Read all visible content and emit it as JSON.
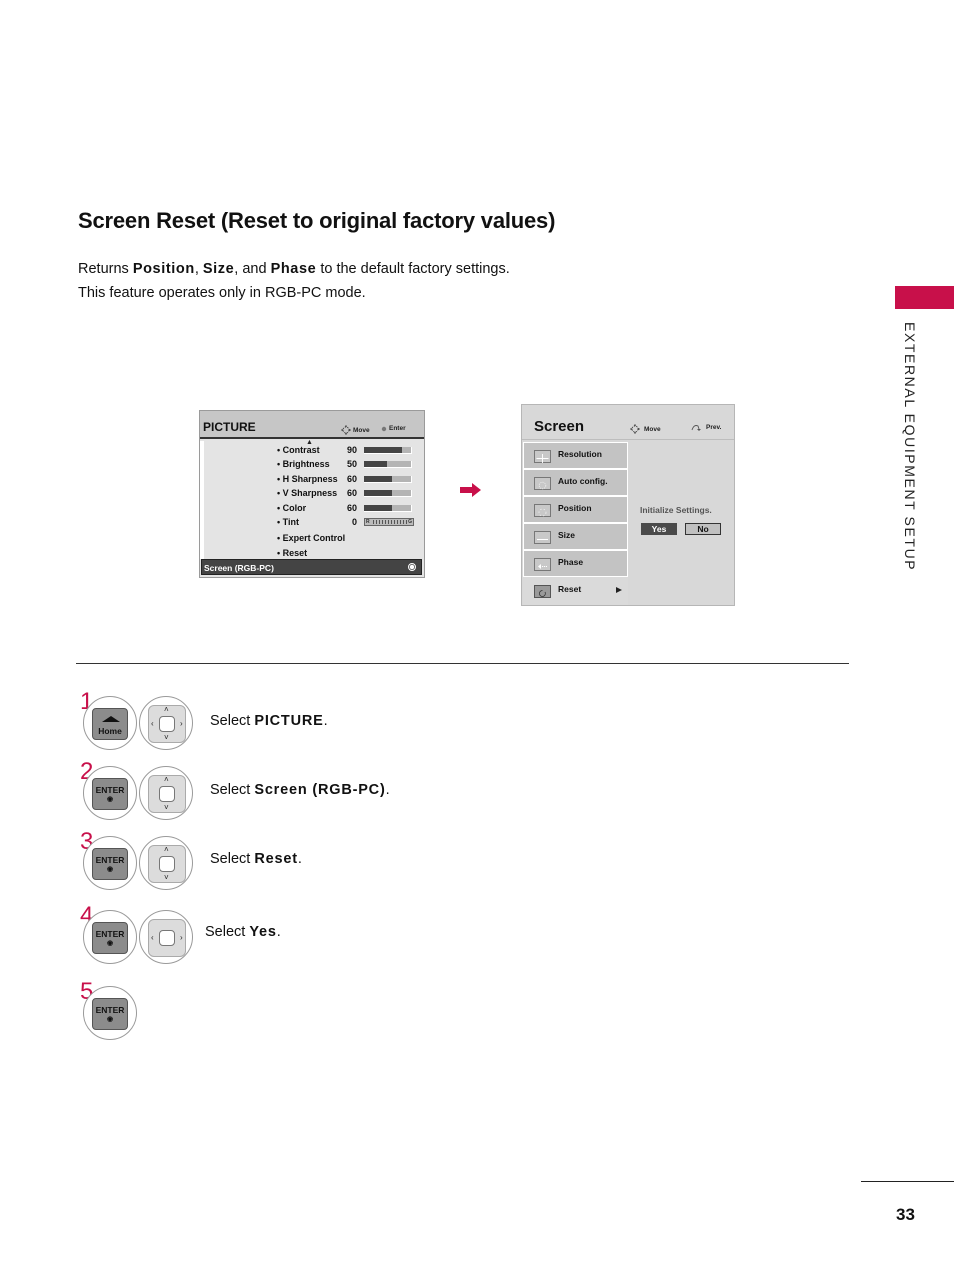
{
  "page": {
    "title": "Screen Reset (Reset to original factory values)",
    "intro_line1": {
      "prefix": "Returns ",
      "term1": "Position",
      "sep1": ", ",
      "term2": "Size",
      "sep2": ", and ",
      "term3": "Phase",
      "suffix": " to the default factory settings."
    },
    "intro_line2": "This feature operates only in RGB-PC mode.",
    "side_label": "EXTERNAL EQUIPMENT SETUP",
    "page_number": "33",
    "accent_color": "#c8104a"
  },
  "picture_menu": {
    "title": "PICTURE",
    "hint_move": "Move",
    "hint_enter": "Enter",
    "items": [
      {
        "label": "• Contrast",
        "value": "90",
        "level": 0.8
      },
      {
        "label": "• Brightness",
        "value": "50",
        "level": 0.48
      },
      {
        "label": "• H Sharpness",
        "value": "60",
        "level": 0.6
      },
      {
        "label": "• V Sharpness",
        "value": "60",
        "level": 0.6
      },
      {
        "label": "• Color",
        "value": "60",
        "level": 0.6
      },
      {
        "label": "• Tint",
        "value": "0"
      },
      {
        "label": "• Expert Control"
      },
      {
        "label": "• Reset"
      }
    ],
    "tint_left": "R",
    "tint_right": "G",
    "footer": "Screen (RGB-PC)"
  },
  "screen_menu": {
    "title": "Screen",
    "hint_move": "Move",
    "hint_prev": "Prev.",
    "items": [
      {
        "label": "Resolution",
        "icon": "resolution-icon"
      },
      {
        "label": "Auto config.",
        "icon": "auto-config-icon"
      },
      {
        "label": "Position",
        "icon": "position-icon"
      },
      {
        "label": "Size",
        "icon": "size-icon"
      },
      {
        "label": "Phase",
        "icon": "phase-icon"
      },
      {
        "label": "Reset",
        "icon": "reset-icon",
        "selected": true
      }
    ],
    "message": "Initialize Settings.",
    "yes_label": "Yes",
    "no_label": "No"
  },
  "steps": [
    {
      "number": "1",
      "key": "Home",
      "text_prefix": "Select ",
      "text_bold": "PICTURE",
      "text_suffix": "."
    },
    {
      "number": "2",
      "key": "ENTER",
      "text_prefix": "Select ",
      "text_bold": "Screen (RGB-PC)",
      "text_suffix": "."
    },
    {
      "number": "3",
      "key": "ENTER",
      "text_prefix": "Select ",
      "text_bold": "Reset",
      "text_suffix": "."
    },
    {
      "number": "4",
      "key": "ENTER",
      "text_prefix": "Select ",
      "text_bold": "Yes",
      "text_suffix": "."
    },
    {
      "number": "5",
      "key": "ENTER"
    }
  ],
  "enter_symbol": "◉"
}
